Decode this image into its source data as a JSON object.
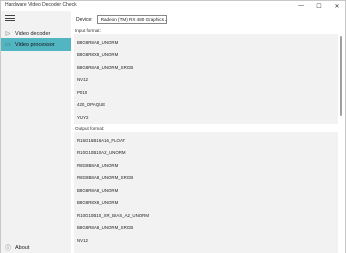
{
  "window": {
    "title": "Hardware Video Decoder Check",
    "minimize_glyph": "—",
    "maximize_glyph": "☐",
    "close_glyph": "✕"
  },
  "sidebar": {
    "menu_icon": "hamburger-icon",
    "items": [
      {
        "label": "Video decoder",
        "icon": "play-icon",
        "icon_glyph": "▷",
        "selected": false
      },
      {
        "label": "Video processor",
        "icon": "video-icon",
        "icon_glyph": "▭",
        "selected": true
      }
    ],
    "about": {
      "label": "About",
      "icon": "info-icon",
      "icon_glyph": "ⓘ"
    }
  },
  "device": {
    "label": "Device:",
    "selected": "Radeon (TM) RX 480 Graphics"
  },
  "input_format": {
    "header": "Input format:",
    "items": [
      "B8G8R8A8_UNORM",
      "B8G8R8X8_UNORM",
      "B8G8R8A8_UNORM_SRGB",
      "NV12",
      "P010",
      "420_OPAQUE",
      "YUY2"
    ]
  },
  "output_format": {
    "header": "Output format:",
    "items": [
      "R16G16B16A16_FLOAT",
      "R10G10B10A2_UNORM",
      "R8G8B8A8_UNORM",
      "R8G8B8A8_UNORM_SRGB",
      "B8G8R8A8_UNORM",
      "B8G8R8X8_UNORM",
      "R10G10B10_XR_BIAS_A2_UNORM",
      "B8G8R8A8_UNORM_SRGB",
      "NV12"
    ]
  },
  "colors": {
    "selected_nav": "#52b5c2",
    "sidebar_bg": "#f2f2f2",
    "list_bg": "#f2f2f2"
  }
}
